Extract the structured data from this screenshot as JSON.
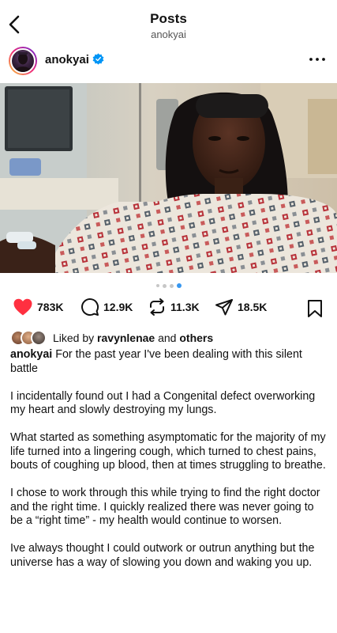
{
  "header": {
    "title": "Posts",
    "subtitle": "anokyai"
  },
  "author": {
    "username": "anokyai",
    "verified": true
  },
  "carousel": {
    "total": 4,
    "active_index": 3
  },
  "actions": {
    "likes": "783K",
    "comments": "12.9K",
    "reposts": "11.3K",
    "shares": "18.5K"
  },
  "liked_by": {
    "prefix": "Liked by",
    "user": "ravynlenae",
    "conjunction": "and",
    "others": "others"
  },
  "caption": {
    "username": "anokyai",
    "paragraphs": [
      "For the past year I've been dealing with this silent battle",
      "I incidentally found out I had a Congenital defect overworking my heart and slowly destroying my lungs.",
      "What started as something asymptomatic for the majority of my life turned into a lingering cough, which turned to chest pains, bouts of coughing up blood, then at times struggling to breathe.",
      "I chose to work through this while trying to find the right doctor and the right time. I quickly realized there was never going to be a “right time” - my health would continue to worsen.",
      "Ive always thought I could outwork or outrun anything but the universe has a way of slowing you down and waking you up."
    ]
  },
  "colors": {
    "like_red": "#ff3040",
    "verified_blue": "#0095f6",
    "active_dot": "#3797f0"
  },
  "icons": {
    "back": "chevron-left-icon",
    "more": "more-horizontal-icon",
    "like": "heart-icon",
    "comment": "comment-icon",
    "repost": "repost-icon",
    "share": "paper-plane-icon",
    "save": "bookmark-icon"
  }
}
